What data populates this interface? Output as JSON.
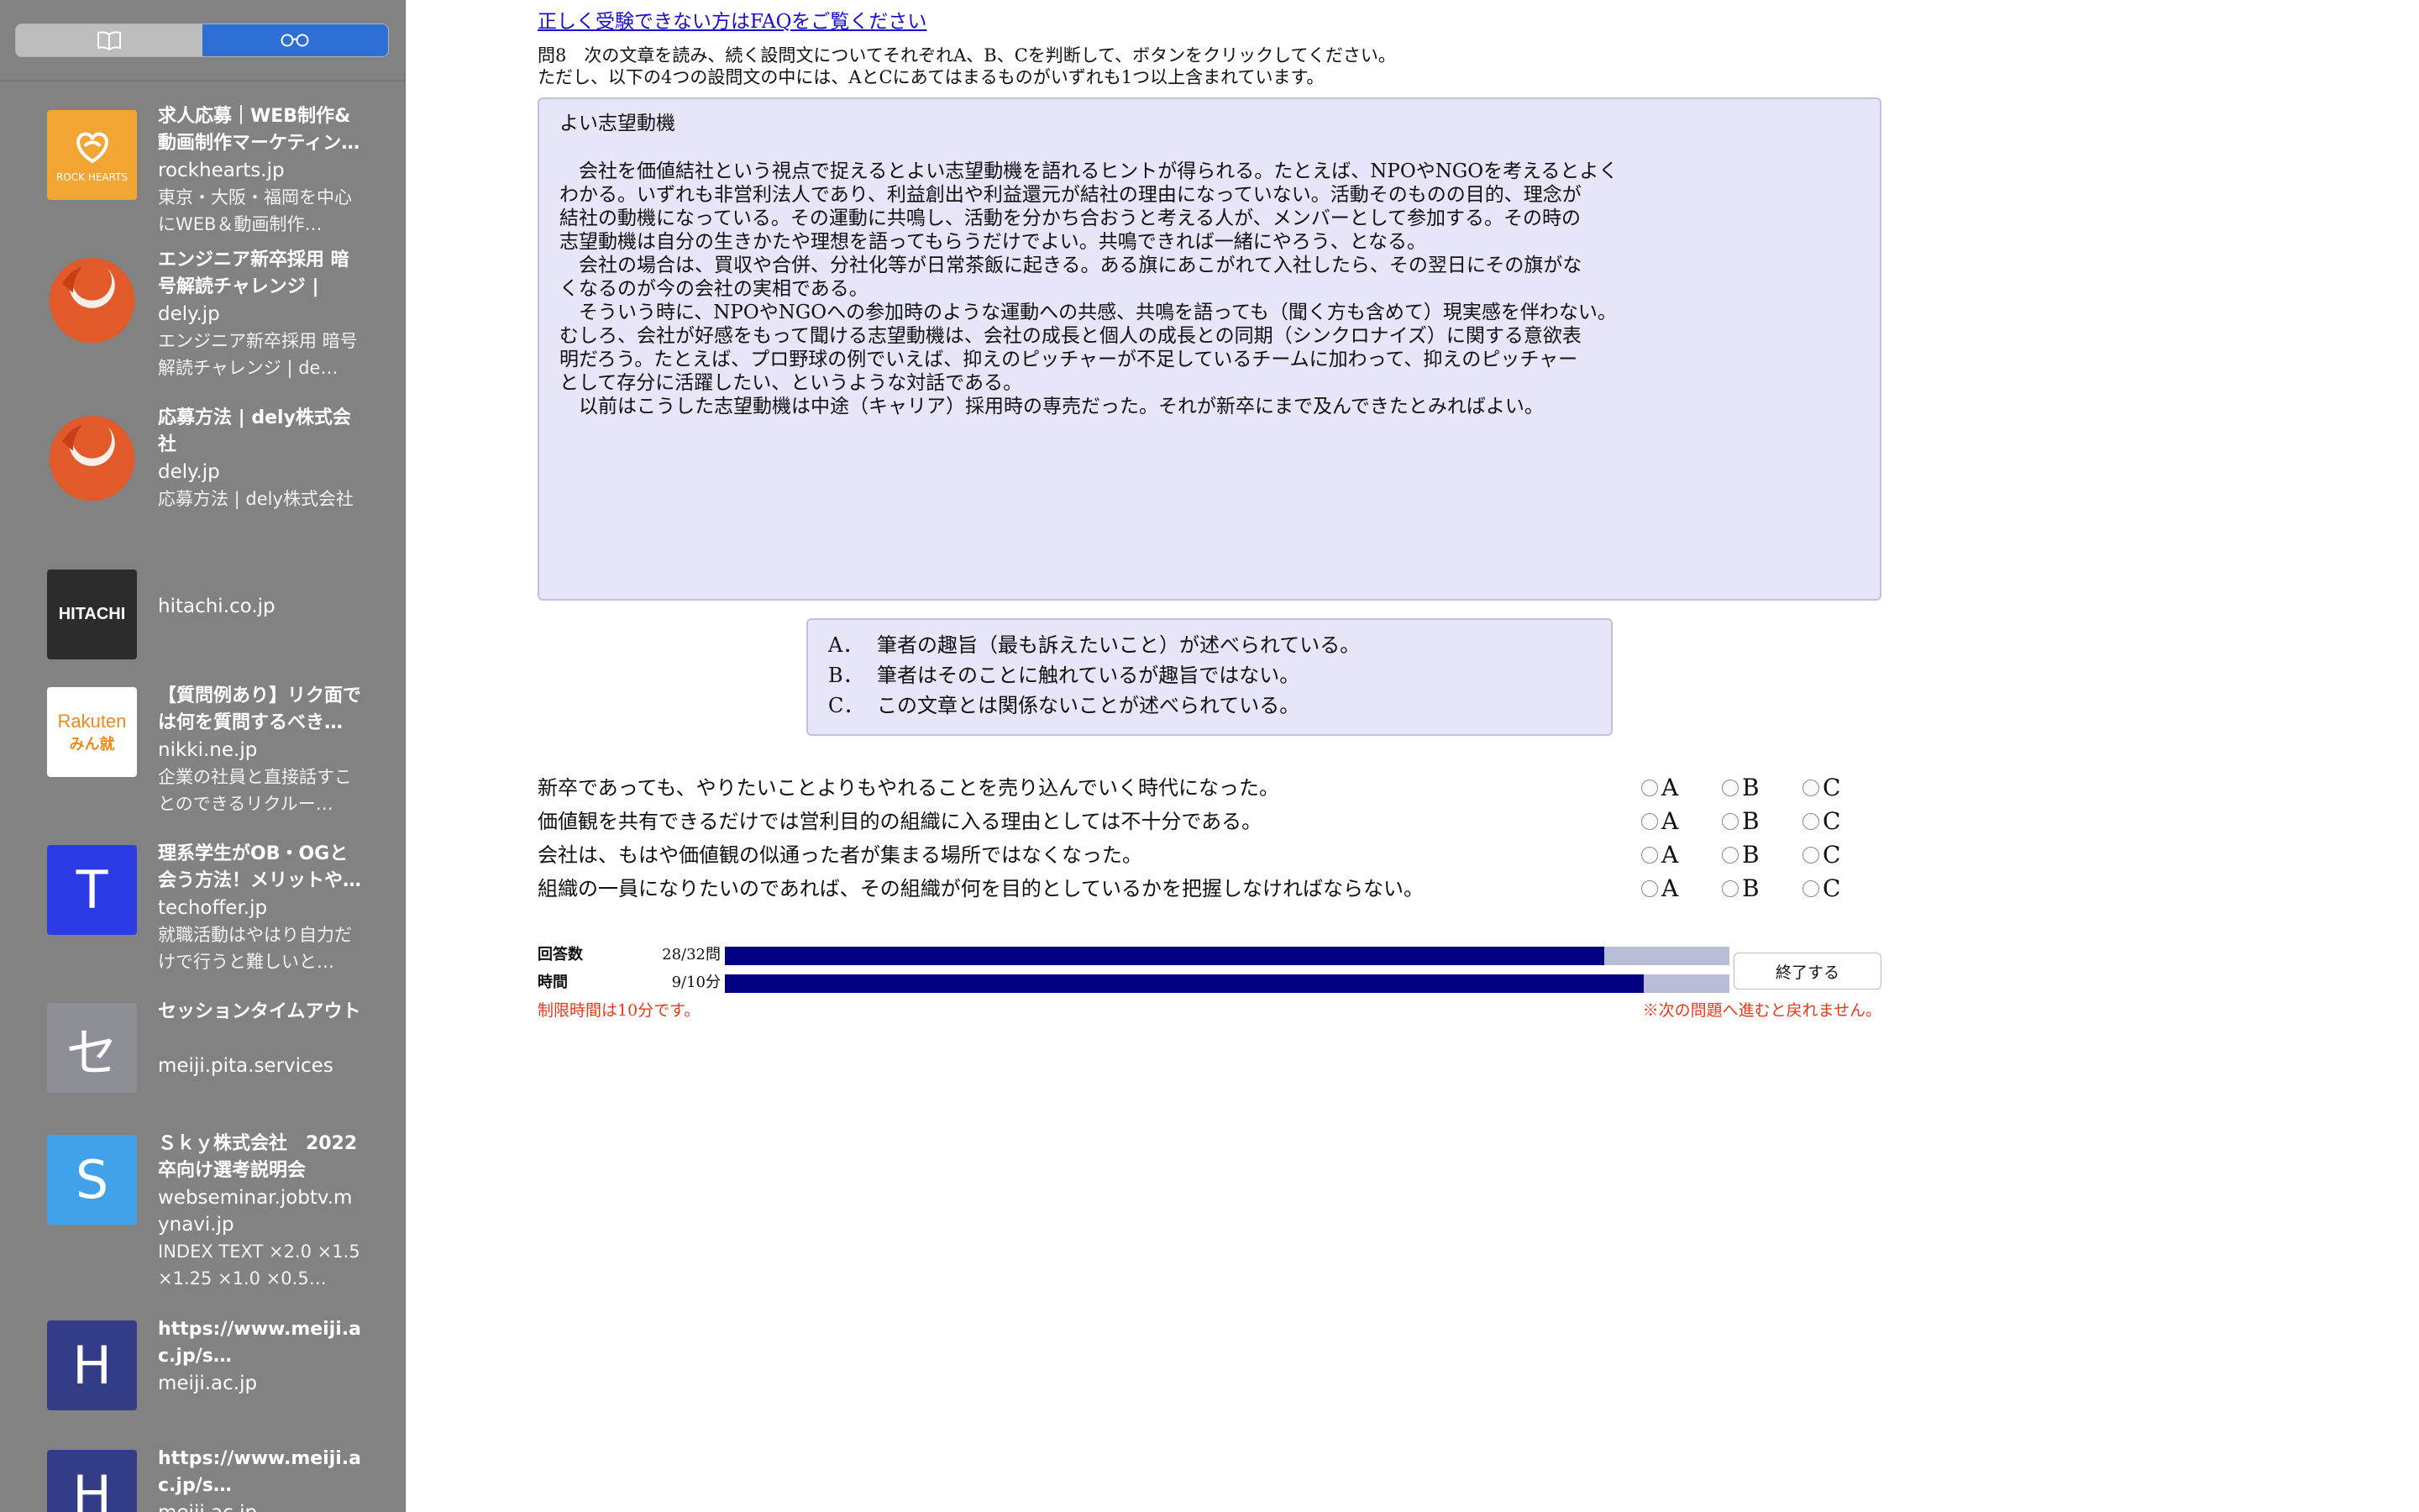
{
  "colors": {
    "sidebar_bg": "#828282",
    "segment_active": "#2e6fd6",
    "panel_bg": "#e6e6f8",
    "bar_fill": "#000080",
    "bar_track": "#b9bcd6",
    "link": "#1a0dcc",
    "note_red": "#e33a1b"
  },
  "sidebar": {
    "segments": [
      {
        "icon": "book-icon"
      },
      {
        "icon": "glasses-icon",
        "selected": true
      }
    ],
    "items": [
      {
        "thumb": "rockhearts-logo",
        "thumb_text": "ROCK HEARTS",
        "title": "求人応募｜WEB制作&動画制作マーケティン…",
        "domain": "rockhearts.jp",
        "desc": "東京・大阪・福岡を中心にWEB＆動画制作…"
      },
      {
        "thumb": "dely-logo",
        "title": "エンジニア新卒採用 暗号解読チャレンジ | de…",
        "domain": "dely.jp",
        "desc": "エンジニア新卒採用 暗号解読チャレンジ | de…"
      },
      {
        "thumb": "dely-logo",
        "title": "応募方法 | dely株式会社",
        "domain": "dely.jp",
        "desc": "応募方法 | dely株式会社"
      },
      {
        "thumb": "hitachi-logo",
        "thumb_text": "HITACHI",
        "title": "",
        "domain": "hitachi.co.jp",
        "desc": ""
      },
      {
        "thumb": "rakuten-logo",
        "thumb_text": "Rakuten",
        "thumb_sub": "みん就",
        "title": "【質問例あり】リク面では何を質問するべき…",
        "domain": "nikki.ne.jp",
        "desc": "企業の社員と直接話すことのできるリクルー…"
      },
      {
        "thumb": "letter-tile",
        "thumb_text": "T",
        "title": "理系学生がOB・OGと会う方法！メリットや…",
        "domain": "techoffer.jp",
        "desc": "就職活動はやはり自力だけで行うと難しいと…"
      },
      {
        "thumb": "letter-tile",
        "thumb_text": "セ",
        "title": "セッションタイムアウト",
        "domain": "meiji.pita.services",
        "desc": ""
      },
      {
        "thumb": "letter-tile",
        "thumb_text": "S",
        "title": "Ｓｋｙ株式会社　2022卒向け選考説明会",
        "domain": "webseminar.jobtv.mynavi.jp",
        "desc": "INDEX TEXT ×2.0 ×1.5 ×1.25 ×1.0 ×0.5…"
      },
      {
        "thumb": "letter-tile",
        "thumb_text": "H",
        "title": "https://www.meiji.ac.jp/s…",
        "domain": "meiji.ac.jp",
        "desc": ""
      },
      {
        "thumb": "letter-tile",
        "thumb_text": "H",
        "title": "https://www.meiji.ac.jp/s…",
        "domain": "meiji.ac.jp",
        "desc": ""
      }
    ]
  },
  "main": {
    "faq_link": "正しく受験できない方はFAQをご覧ください",
    "instruction_1": "問8　次の文章を読み、続く設問文についてそれぞれA、B、Cを判断して、ボタンをクリックしてください。",
    "instruction_2": "ただし、以下の4つの設問文の中には、AとCにあてはまるものがいずれも1つ以上含まれています。",
    "passage": {
      "title": "よい志望動機",
      "lines": [
        "　会社を価値結社という視点で捉えるとよい志望動機を語れるヒントが得られる。たとえば、NPOやNGOを考えるとよく",
        "わかる。いずれも非営利法人であり、利益創出や利益還元が結社の理由になっていない。活動そのものの目的、理念が",
        "結社の動機になっている。その運動に共鳴し、活動を分かち合おうと考える人が、メンバーとして参加する。その時の",
        "志望動機は自分の生きかたや理想を語ってもらうだけでよい。共鳴できれば一緒にやろう、となる。",
        "　会社の場合は、買収や合併、分社化等が日常茶飯に起きる。ある旗にあこがれて入社したら、その翌日にその旗がな",
        "くなるのが今の会社の実相である。",
        "　そういう時に、NPOやNGOへの参加時のような運動への共感、共鳴を語っても（聞く方も含めて）現実感を伴わない。",
        "むしろ、会社が好感をもって聞ける志望動機は、会社の成長と個人の成長との同期（シンクロナイズ）に関する意欲表",
        "明だろう。たとえば、プロ野球の例でいえば、抑えのピッチャーが不足しているチームに加わって、抑えのピッチャー",
        "として存分に活躍したい、というような対話である。",
        "　以前はこうした志望動機は中途（キャリア）採用時の専売だった。それが新卒にまで及んできたとみればよい。"
      ]
    },
    "legend": [
      {
        "key": "A．",
        "text": "筆者の趣旨（最も訴えたいこと）が述べられている。"
      },
      {
        "key": "B．",
        "text": "筆者はそのことに触れているが趣旨ではない。"
      },
      {
        "key": "C．",
        "text": "この文章とは関係ないことが述べられている。"
      }
    ],
    "questions": [
      {
        "text": "新卒であっても、やりたいことよりもやれることを売り込んでいく時代になった。",
        "options": [
          "A",
          "B",
          "C"
        ]
      },
      {
        "text": "価値観を共有できるだけでは営利目的の組織に入る理由としては不十分である。",
        "options": [
          "A",
          "B",
          "C"
        ]
      },
      {
        "text": "会社は、もはや価値観の似通った者が集まる場所ではなくなった。",
        "options": [
          "A",
          "B",
          "C"
        ]
      },
      {
        "text": "組織の一員になりたいのであれば、その組織が何を目的としているかを把握しなければならない。",
        "options": [
          "A",
          "B",
          "C"
        ]
      }
    ],
    "progress": {
      "answered_label": "回答数",
      "answered_value": "28/32問",
      "answered_fraction": 0.875,
      "time_label": "時間",
      "time_value": "9/10分",
      "time_fraction": 0.915
    },
    "end_button": "終了する",
    "time_limit_note": "制限時間は10分です。",
    "no_return_note": "※次の問題へ進むと戻れません。"
  }
}
